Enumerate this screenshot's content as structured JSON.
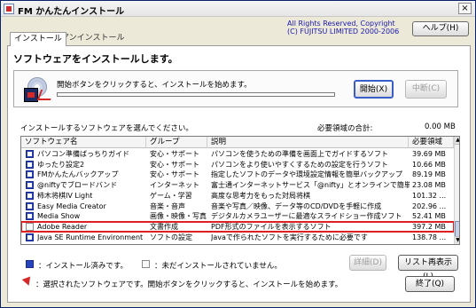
{
  "window": {
    "title": "FM かんたんインストール",
    "close_label": "×"
  },
  "header": {
    "copyright_line1": "All Rights Reserved, Copyright",
    "copyright_line2": "(C) FUJITSU LIMITED  2000-2006",
    "help_label": "ヘルプ(H)"
  },
  "tabs": [
    {
      "label": "インストール"
    },
    {
      "label": "アンインストール"
    }
  ],
  "install": {
    "headline": "ソフトウェアをインストールします。",
    "status_message": "開始ボタンをクリックすると、インストールを始めます。",
    "progress": 0,
    "start_label": "開始(X)",
    "stop_label": "中断(C)"
  },
  "list": {
    "label": "インストールするソフトウェアを選んでください。",
    "required_label": "必要領域の合計:",
    "required_value": "0.00 MB",
    "columns": [
      "ソフトウェア名",
      "グループ",
      "説明",
      "必要領域"
    ],
    "rows": [
      {
        "name": "パソコン準備ばっちりガイド",
        "group": "安心・サポート",
        "desc": "パソコンを使うための準備を画面上でガイドするソフト",
        "size": "39.69 MB",
        "installed": true
      },
      {
        "name": "ゆったり設定2",
        "group": "安心・サポート",
        "desc": "パソコンをより使いやすくするための設定を行うソフト",
        "size": "10.66 MB",
        "installed": true
      },
      {
        "name": "FMかんたんバックアップ",
        "group": "安心・サポート",
        "desc": "指定したソフトのデータや環境設定情報を簡単バックアップ",
        "size": "89.19 MB",
        "installed": true
      },
      {
        "name": "@niftyでブロードバンド",
        "group": "インターネット",
        "desc": "富士通インターネットサービス「@nifty」とオンラインで簡単契約",
        "size": "23.08 MB",
        "installed": true
      },
      {
        "name": "柿木将棋IV Light",
        "group": "ゲーム・学習",
        "desc": "高度な思考力をもった対局将棋",
        "size": "101.32 ...",
        "installed": true
      },
      {
        "name": "Easy Media Creator",
        "group": "音楽・音声",
        "desc": "音楽や写真／映像、データ等のCD/DVDを手軽に作成",
        "size": "202.96 ...",
        "installed": true
      },
      {
        "name": "Media Show",
        "group": "画像・映像・写真",
        "desc": "デジタルカメラユーザーに最適なスライドショー作成ソフト",
        "size": "52.41 MB",
        "installed": true
      },
      {
        "name": "Adobe Reader",
        "group": "文書作成",
        "desc": "PDF形式のファイルを表示するソフト",
        "size": "397.2 MB",
        "installed": false
      },
      {
        "name": "Java SE Runtime Environment",
        "group": "ソフトの設定",
        "desc": "Javaで作られたソフトを実行するために必要です",
        "size": "138.78 ...",
        "installed": true
      }
    ]
  },
  "footer": {
    "legend_installed": "：インストール済みです。",
    "legend_not_installed": "：未だインストールされていません。",
    "note": "：選択されたソフトウェアです。開始ボタンをクリックすると、インストールを始めます。",
    "detail_label": "詳細(D)",
    "redisplay_label": "リスト再表示(L)",
    "end_label": "終了(Q)"
  }
}
